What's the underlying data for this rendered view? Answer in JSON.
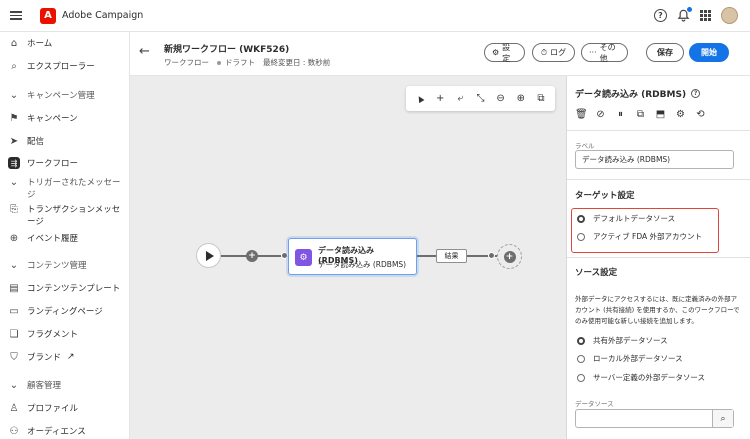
{
  "app": {
    "title": "Adobe Campaign",
    "logo": "A"
  },
  "topbar": {
    "help_icon": "?",
    "bell_icon": "bell-icon",
    "grid_icon": "apps-grid-icon"
  },
  "sidebar": {
    "items": [
      {
        "label": "ホーム",
        "icon": "⌂",
        "type": "item"
      },
      {
        "label": "エクスプローラー",
        "icon": "⌕",
        "type": "item"
      },
      {
        "label": "キャンペーン管理",
        "icon": "⌄",
        "type": "section"
      },
      {
        "label": "キャンペーン",
        "icon": "⚑",
        "type": "item"
      },
      {
        "label": "配信",
        "icon": "➤",
        "type": "item"
      },
      {
        "label": "ワークフロー",
        "icon": "⇶",
        "type": "active"
      },
      {
        "label": "トリガーされたメッセージ",
        "icon": "⌄",
        "type": "section"
      },
      {
        "label": "トランザクションメッセージ",
        "icon": "⎘",
        "type": "item"
      },
      {
        "label": "イベント履歴",
        "icon": "⊕",
        "type": "item"
      },
      {
        "label": "コンテンツ管理",
        "icon": "⌄",
        "type": "section"
      },
      {
        "label": "コンテンツテンプレート",
        "icon": "▤",
        "type": "item"
      },
      {
        "label": "ランディングページ",
        "icon": "▭",
        "type": "item"
      },
      {
        "label": "フラグメント",
        "icon": "❏",
        "type": "item"
      },
      {
        "label": "ブランド",
        "icon": "⛉",
        "type": "item"
      },
      {
        "label": "顧客管理",
        "icon": "⌄",
        "type": "section"
      },
      {
        "label": "プロファイル",
        "icon": "♙",
        "type": "item"
      },
      {
        "label": "オーディエンス",
        "icon": "⚇",
        "type": "item"
      }
    ]
  },
  "header": {
    "title": "新規ワークフロー (WKF526)",
    "type_label": "ワークフロー",
    "status": "ドラフト",
    "modified": "最終変更日 : 数秒前",
    "buttons": {
      "settings": "設定",
      "logs": "ログ",
      "more": "その他",
      "save": "保存",
      "start": "開始"
    }
  },
  "canvas": {
    "toolbar": [
      "▲",
      "+",
      "⤶",
      "⤡",
      "⊖",
      "⊕",
      "⧉"
    ],
    "activity": {
      "title": "データ読み込み (RDBMS)",
      "subtitle": "データ読み込み (RDBMS)",
      "icon": "⚙"
    },
    "result_label": "結果"
  },
  "panel": {
    "title": "データ読み込み (RDBMS)",
    "tools": [
      "🗑",
      "⊘",
      "⏸",
      "⧉",
      "⬒",
      "⚙",
      "⟲"
    ],
    "label_field": {
      "label": "ラベル",
      "value": "データ読み込み (RDBMS)"
    },
    "target_section": "ターゲット設定",
    "target_options": [
      {
        "label": "デフォルトデータソース",
        "checked": true
      },
      {
        "label": "アクティブ FDA 外部アカウント",
        "checked": false
      }
    ],
    "source_section": "ソース設定",
    "source_desc": "外部データにアクセスするには、既に定義済みの外部アカウント (共有接続) を使用するか、このワークフローでのみ使用可能な新しい接続を追加します。",
    "source_options": [
      {
        "label": "共有外部データソース",
        "checked": true
      },
      {
        "label": "ローカル外部データソース",
        "checked": false
      },
      {
        "label": "サーバー定義の外部データソース",
        "checked": false
      }
    ],
    "datasource_label": "データソース",
    "datasource_btn": "⌕"
  }
}
